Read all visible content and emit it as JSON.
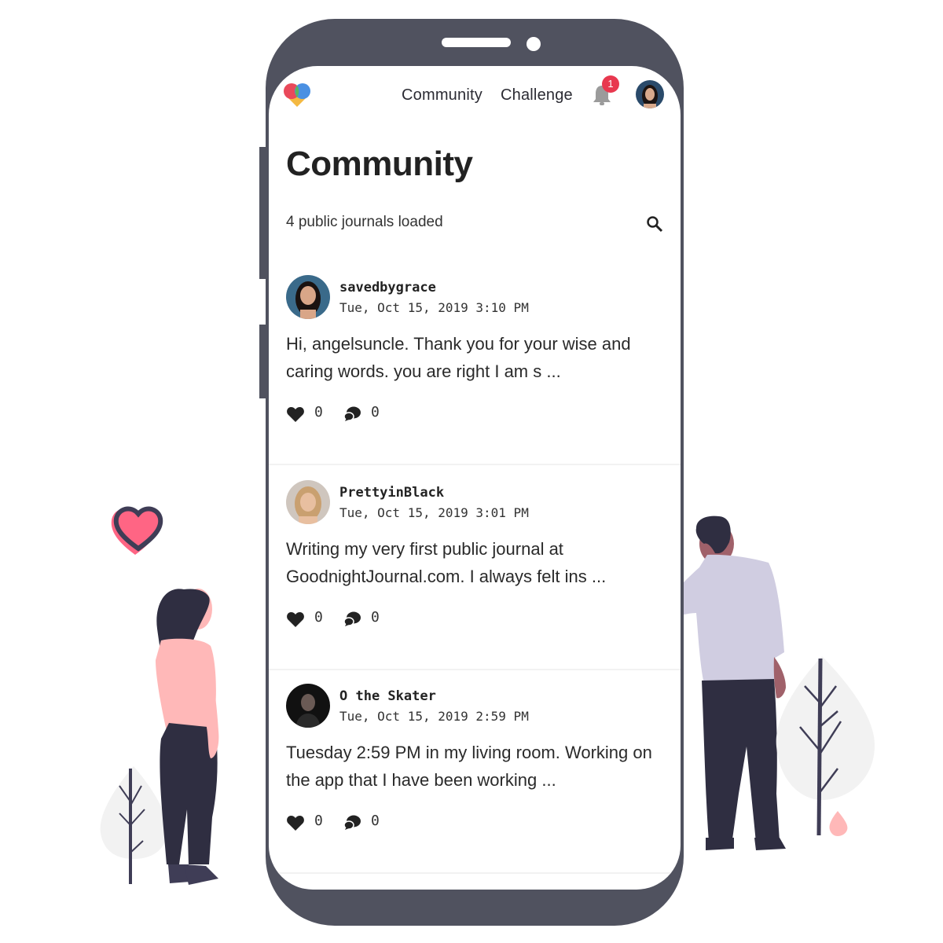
{
  "app": {
    "nav": {
      "links": [
        "Community",
        "Challenge"
      ],
      "notification_count": "1"
    },
    "page_title": "Community",
    "status_text": "4 public journals loaded",
    "posts": [
      {
        "username": "savedbygrace",
        "timestamp": "Tue, Oct 15, 2019 3:10 PM",
        "excerpt": "Hi, angelsuncle. Thank you for your wise and caring words. you are right I am s ...",
        "likes": "0",
        "comments": "0"
      },
      {
        "username": "PrettyinBlack",
        "timestamp": "Tue, Oct 15, 2019 3:01 PM",
        "excerpt": "Writing my very first public journal at GoodnightJournal.com. I always felt ins ...",
        "likes": "0",
        "comments": "0"
      },
      {
        "username": "O the Skater",
        "timestamp": "Tue, Oct 15, 2019 2:59 PM",
        "excerpt": "Tuesday 2:59 PM in my living room. Working on the app that I have been working ...",
        "likes": "0",
        "comments": "0"
      }
    ],
    "icons": {
      "logo": "heart-logo-icon",
      "bell": "bell-icon",
      "search": "search-icon",
      "like": "heart-icon",
      "comment": "comment-bubbles-icon"
    },
    "colors": {
      "frame": "#50525f",
      "badge": "#e8384f",
      "accent_pink": "#ff6584",
      "text": "#222222"
    }
  }
}
